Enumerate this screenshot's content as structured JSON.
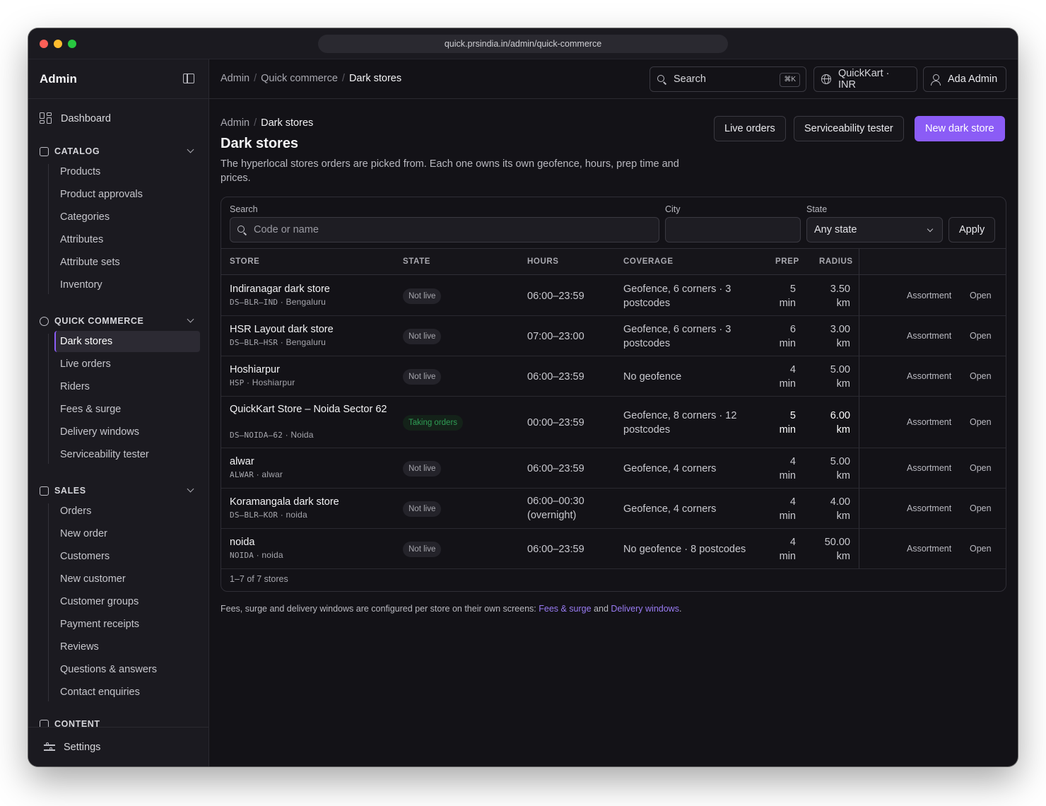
{
  "browser": {
    "url": "quick.prsindia.in/admin/quick-commerce"
  },
  "sidebar": {
    "title": "Admin",
    "dashboard": "Dashboard",
    "catalog": {
      "label": "CATALOG",
      "items": [
        "Products",
        "Product approvals",
        "Categories",
        "Attributes",
        "Attribute sets",
        "Inventory"
      ]
    },
    "quick_commerce": {
      "label": "QUICK COMMERCE",
      "items": [
        "Dark stores",
        "Live orders",
        "Riders",
        "Fees & surge",
        "Delivery windows",
        "Serviceability tester"
      ]
    },
    "sales": {
      "label": "SALES",
      "items": [
        "Orders",
        "New order",
        "Customers",
        "New customer",
        "Customer groups",
        "Payment receipts",
        "Reviews",
        "Questions & answers",
        "Contact enquiries"
      ]
    },
    "next_section_partial": "CONTENT",
    "settings": "Settings"
  },
  "topbar": {
    "breadcrumb": [
      "Admin",
      "Quick commerce",
      "Dark stores"
    ],
    "search_label": "Search",
    "search_shortcut": "⌘K",
    "store_selector": "QuickKart · INR",
    "user": "Ada Admin"
  },
  "page": {
    "breadcrumb": [
      "Admin",
      "Dark stores"
    ],
    "title": "Dark stores",
    "description": "The hyperlocal stores orders are picked from. Each one owns its own geofence, hours, prep time and prices.",
    "actions": {
      "live_orders": "Live orders",
      "tester": "Serviceability tester",
      "new": "New dark store"
    }
  },
  "filters": {
    "search_label": "Search",
    "search_placeholder": "Code or name",
    "city_label": "City",
    "city_value": "",
    "state_label": "State",
    "state_value": "Any state",
    "apply": "Apply"
  },
  "table": {
    "headers": {
      "store": "STORE",
      "state": "STATE",
      "hours": "HOURS",
      "coverage": "COVERAGE",
      "prep": "PREP",
      "radius": "RADIUS"
    },
    "row_actions": {
      "assortment": "Assortment",
      "open": "Open"
    },
    "rows": [
      {
        "name": "Indiranagar dark store",
        "code": "DS–BLR–IND",
        "city": "Bengaluru",
        "state": "Not live",
        "hours": "06:00–23:59",
        "coverage": "Geofence, 6 corners · 3 postcodes",
        "prep": "5",
        "prep_unit": "min",
        "radius": "3.50",
        "radius_unit": "km",
        "live": false
      },
      {
        "name": "HSR Layout dark store",
        "code": "DS–BLR–HSR",
        "city": "Bengaluru",
        "state": "Not live",
        "hours": "07:00–23:00",
        "coverage": "Geofence, 6 corners · 3 postcodes",
        "prep": "6",
        "prep_unit": "min",
        "radius": "3.00",
        "radius_unit": "km",
        "live": false
      },
      {
        "name": "Hoshiarpur",
        "code": "HSP",
        "city": "Hoshiarpur",
        "state": "Not live",
        "hours": "06:00–23:59",
        "coverage": "No geofence",
        "prep": "4",
        "prep_unit": "min",
        "radius": "5.00",
        "radius_unit": "km",
        "live": false
      },
      {
        "name": "QuickKart Store – Noida Sector 62",
        "code": "DS–NOIDA–62",
        "city": "Noida",
        "state": "Taking orders",
        "hours": "00:00–23:59",
        "coverage": "Geofence, 8 corners · 12 postcodes",
        "prep": "5",
        "prep_unit": "min",
        "radius": "6.00",
        "radius_unit": "km",
        "live": true
      },
      {
        "name": "alwar",
        "code": "ALWAR",
        "city": "alwar",
        "state": "Not live",
        "hours": "06:00–23:59",
        "coverage": "Geofence, 4 corners",
        "prep": "4",
        "prep_unit": "min",
        "radius": "5.00",
        "radius_unit": "km",
        "live": false
      },
      {
        "name": "Koramangala dark store",
        "code": "DS–BLR–KOR",
        "city": "noida",
        "state": "Not live",
        "hours": "06:00–00:30 (overnight)",
        "coverage": "Geofence, 4 corners",
        "prep": "4",
        "prep_unit": "min",
        "radius": "4.00",
        "radius_unit": "km",
        "live": false
      },
      {
        "name": "noida",
        "code": "NOIDA",
        "city": "noida",
        "state": "Not live",
        "hours": "06:00–23:59",
        "coverage": "No geofence · 8 postcodes",
        "prep": "4",
        "prep_unit": "min",
        "radius": "50.00",
        "radius_unit": "km",
        "live": false
      }
    ],
    "footer": "1–7 of 7 stores"
  },
  "note": {
    "text": "Fees, surge and delivery windows are configured per store on their own screens: ",
    "link1": "Fees & surge",
    "and": " and ",
    "link2": "Delivery windows",
    "end": "."
  },
  "colors": {
    "accent": "#8b5cf6",
    "live": "#2f9e55",
    "bg": "#131217"
  }
}
